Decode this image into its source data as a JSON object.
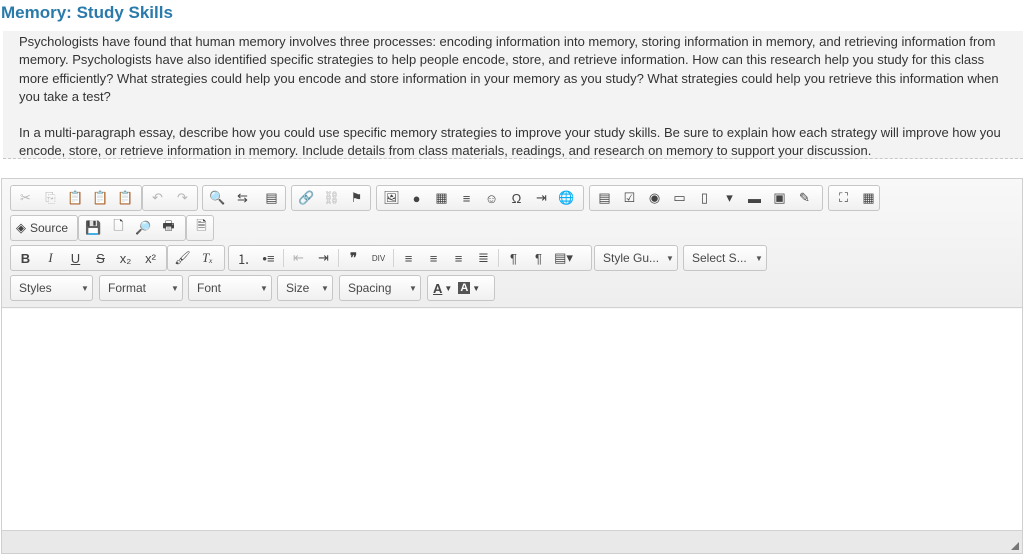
{
  "page": {
    "title": "Memory: Study Skills"
  },
  "prompt": {
    "paragraphs": [
      "Psychologists have found that human memory involves three processes: encoding information into memory, storing information in memory, and retrieving information from memory. Psychologists have also identified specific strategies to help people encode, store, and retrieve information. How can this research help you study for this class more efficiently? What strategies could help you encode and store information in your memory as you study? What strategies could help you retrieve this information when you take a test?",
      "In a multi-paragraph essay, describe how you could use specific memory strategies to improve your study skills. Be sure to explain how each strategy will improve how you encode, store, or retrieve information in memory. Include details from class materials, readings, and research on memory to support your discussion."
    ]
  },
  "editor": {
    "source_label": "Source",
    "combos": {
      "style_guide": "Style Gu...",
      "select_s": "Select S...",
      "styles": "Styles",
      "format": "Format",
      "font": "Font",
      "size": "Size",
      "spacing": "Spacing"
    },
    "content": ""
  }
}
